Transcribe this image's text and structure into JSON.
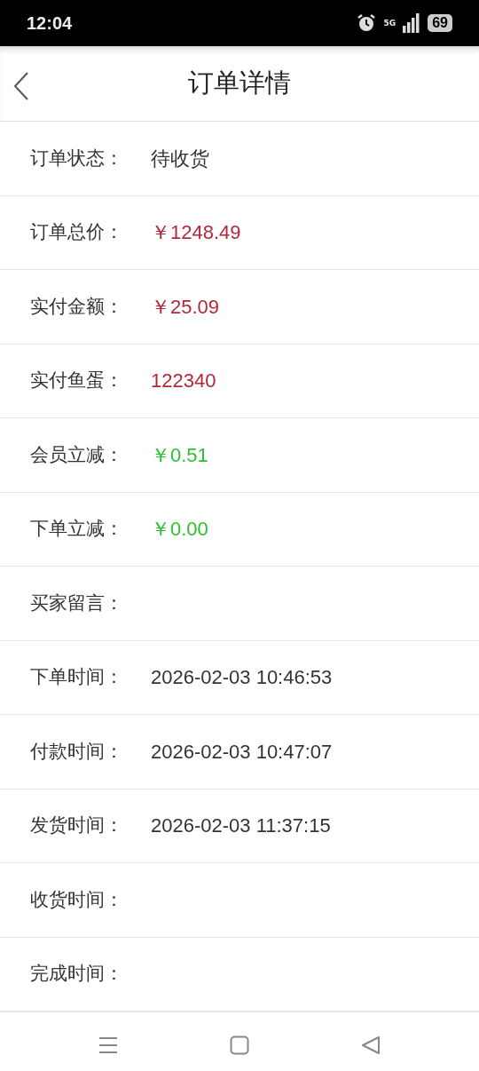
{
  "status_bar": {
    "time": "12:04",
    "network": "5G",
    "battery": "69"
  },
  "header": {
    "title": "订单详情"
  },
  "rows": [
    {
      "label": "订单状态：",
      "value": "待收货"
    },
    {
      "label": "订单总价：",
      "value": "￥1248.49",
      "color": "#b0283a"
    },
    {
      "label": "实付金额：",
      "value": "￥25.09",
      "color": "#b0283a"
    },
    {
      "label": "实付鱼蛋：",
      "value": "122340",
      "color": "#b0283a"
    },
    {
      "label": "会员立减：",
      "value": "￥0.51",
      "color": "#2fbf2f"
    },
    {
      "label": "下单立减：",
      "value": "￥0.00",
      "color": "#2fbf2f"
    },
    {
      "label": "买家留言："
    },
    {
      "label": "下单时间：",
      "value": "2026-02-03 10:46:53"
    },
    {
      "label": "付款时间：",
      "value": "2026-02-03 10:47:07"
    },
    {
      "label": "发货时间：",
      "value": "2026-02-03 11:37:15"
    },
    {
      "label": "收货时间："
    },
    {
      "label": "完成时间："
    }
  ]
}
